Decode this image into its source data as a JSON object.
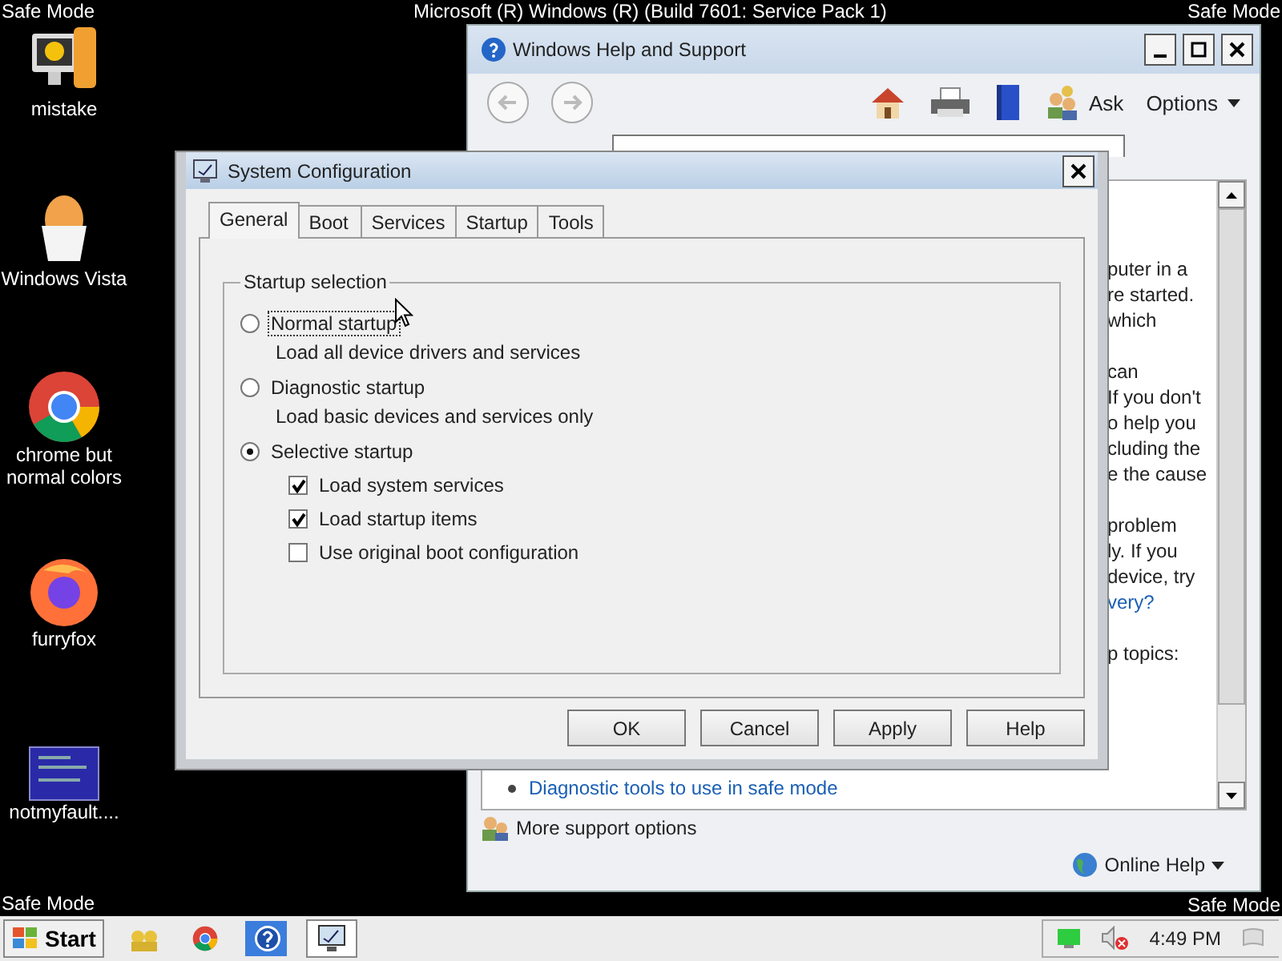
{
  "screen_labels": {
    "top_left": "Safe Mode",
    "top_center": "Microsoft (R) Windows (R) (Build 7601: Service Pack 1)",
    "top_right": "Safe Mode",
    "bottom_left": "Safe Mode",
    "bottom_right": "Safe Mode"
  },
  "desktop_icons": [
    {
      "label": "mistake",
      "kind": "computer"
    },
    {
      "label": "Windows Vista",
      "kind": "egg"
    },
    {
      "label": "chrome but normal colors",
      "kind": "chrome"
    },
    {
      "label": "furryfox",
      "kind": "fox"
    },
    {
      "label": "notmyfault....",
      "kind": "screen"
    }
  ],
  "help_window": {
    "title": "Windows Help and Support",
    "ask": "Ask",
    "options": "Options",
    "paragraphs": [
      [
        {
          "text": "puter in a",
          "link": false
        },
        {
          "text": "re started.",
          "link": false
        },
        {
          "text": "which",
          "link": false
        }
      ],
      [
        {
          "text": "can",
          "link": false
        },
        {
          "text": "If you don't",
          "link": false
        },
        {
          "text": "o help you",
          "link": false
        },
        {
          "text": "cluding the",
          "link": false
        },
        {
          "text": "e the cause",
          "link": false
        }
      ],
      [
        {
          "text": "problem",
          "link": false
        },
        {
          "text": "ly. If you",
          "link": false
        },
        {
          "text": "device, try",
          "link": false
        },
        {
          "text": "very?",
          "link": true
        }
      ],
      [
        {
          "text": "p topics:",
          "link": false
        }
      ]
    ],
    "topic_link": "Diagnostic tools to use in safe mode",
    "more_support": "More support options",
    "online_help": "Online Help"
  },
  "dialog": {
    "title": "System Configuration",
    "tabs": [
      {
        "label": "General",
        "selected": true
      },
      {
        "label": "Boot",
        "selected": false
      },
      {
        "label": "Services",
        "selected": false
      },
      {
        "label": "Startup",
        "selected": false
      },
      {
        "label": "Tools",
        "selected": false
      }
    ],
    "group_title": "Startup selection",
    "options": [
      {
        "kind": "radio",
        "label": "Normal startup",
        "selected": false,
        "focused": true,
        "description": "Load all device drivers and services"
      },
      {
        "kind": "radio",
        "label": "Diagnostic startup",
        "selected": false,
        "focused": false,
        "description": "Load basic devices and services only"
      },
      {
        "kind": "radio",
        "label": "Selective startup",
        "selected": true,
        "focused": false
      },
      {
        "kind": "checkbox",
        "label": "Load system services",
        "checked": true
      },
      {
        "kind": "checkbox",
        "label": "Load startup items",
        "checked": true
      },
      {
        "kind": "checkbox",
        "label": "Use original boot configuration",
        "checked": false
      }
    ],
    "buttons": [
      "OK",
      "Cancel",
      "Apply",
      "Help"
    ]
  },
  "taskbar": {
    "start": "Start",
    "apps": [
      {
        "kind": "people",
        "active": false
      },
      {
        "kind": "chrome",
        "active": false
      },
      {
        "kind": "help",
        "active": false
      },
      {
        "kind": "monitor",
        "active": true
      }
    ],
    "clock": "4:49 PM"
  }
}
